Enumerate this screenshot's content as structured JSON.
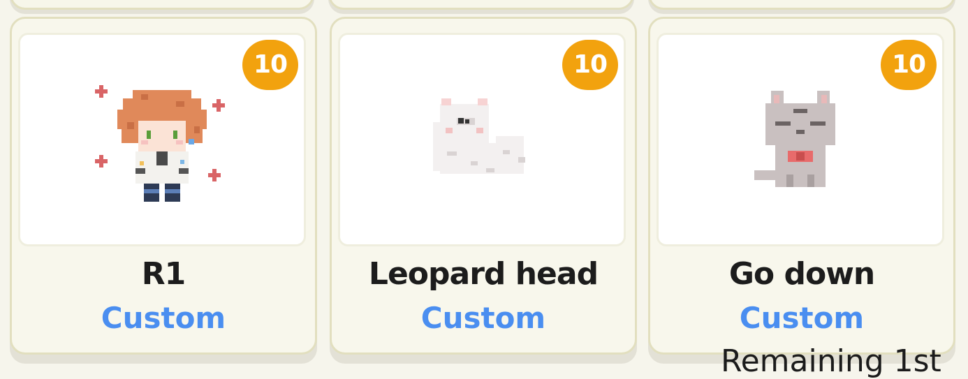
{
  "cards": [
    {
      "title": "R1",
      "tag": "Custom",
      "badge": "10",
      "sprite": "chibi-character-icon"
    },
    {
      "title": "Leopard head",
      "tag": "Custom",
      "badge": "10",
      "sprite": "white-leopard-icon"
    },
    {
      "title": "Go down",
      "tag": "Custom",
      "badge": "10",
      "sprite": "gray-cat-icon"
    }
  ],
  "footer": {
    "remaining_text": "Remaining 1st"
  },
  "colors": {
    "badge": "#f2a20e",
    "tag": "#4a8ef0",
    "card_bg": "#f8f7ec",
    "card_border": "#e2dfbf"
  }
}
